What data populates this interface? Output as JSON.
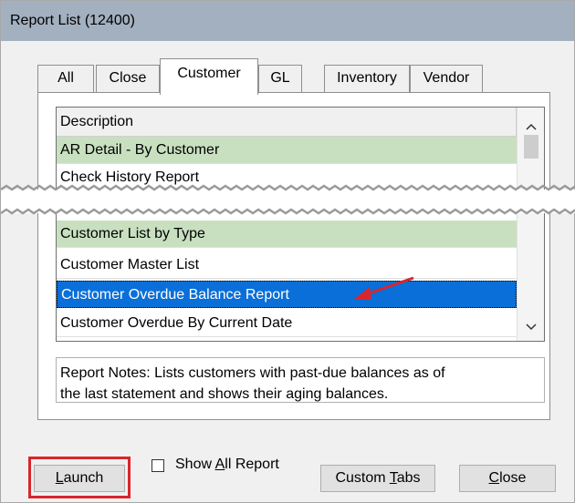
{
  "window": {
    "title": "Report List (12400)"
  },
  "tabs": [
    "All",
    "Close",
    "Customer",
    "GL",
    "Inventory",
    "Vendor"
  ],
  "selected_tab": "Customer",
  "list": {
    "header": "Description",
    "rows_top": [
      "AR Detail - By Customer",
      "Check History Report"
    ],
    "rows_bottom": [
      "Customer List by Type",
      "Customer Master List",
      "Customer Overdue Balance Report",
      "Customer Overdue By Current Date"
    ],
    "selected_row": "Customer Overdue Balance Report"
  },
  "notes": {
    "line1": "Report Notes:  Lists customers with past-due balances as of",
    "line2": "the last statement and shows their aging balances."
  },
  "buttons": {
    "launch_pre": "",
    "launch_ul": "L",
    "launch_post": "aunch",
    "custom_tabs_pre": "Custom ",
    "custom_tabs_ul": "T",
    "custom_tabs_post": "abs",
    "close_pre": "",
    "close_ul": "C",
    "close_post": "lose"
  },
  "checkbox": {
    "pre": "Show ",
    "ul": "A",
    "post": "ll Report",
    "checked": false
  },
  "colors": {
    "selection": "#0a6fd8",
    "highlight_row": "#c8e0c0",
    "callout": "#d8262c"
  }
}
